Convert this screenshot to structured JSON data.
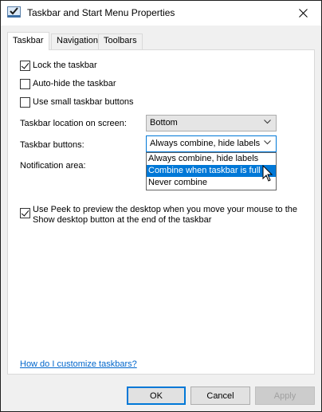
{
  "window": {
    "title": "Taskbar and Start Menu Properties"
  },
  "tabs": [
    {
      "label": "Taskbar",
      "active": true
    },
    {
      "label": "Navigation",
      "active": false
    },
    {
      "label": "Toolbars",
      "active": false
    }
  ],
  "options": {
    "lock_taskbar": {
      "label": "Lock the taskbar",
      "checked": true
    },
    "auto_hide": {
      "label": "Auto-hide the taskbar",
      "checked": false
    },
    "small_buttons": {
      "label": "Use small taskbar buttons",
      "checked": false
    }
  },
  "location": {
    "label": "Taskbar location on screen:",
    "value": "Bottom"
  },
  "buttons": {
    "label": "Taskbar buttons:",
    "value": "Always combine, hide labels",
    "options": [
      "Always combine, hide labels",
      "Combine when taskbar is full",
      "Never combine"
    ],
    "highlighted_index": 1
  },
  "notification": {
    "label": "Notification area:"
  },
  "peek": {
    "label": "Use Peek to preview the desktop when you move your mouse to the Show desktop button at the end of the taskbar",
    "checked": true
  },
  "help_link": "How do I customize taskbars?",
  "footer": {
    "ok": "OK",
    "cancel": "Cancel",
    "apply": "Apply"
  },
  "colors": {
    "accent": "#0078d7",
    "link": "#0066cc"
  }
}
